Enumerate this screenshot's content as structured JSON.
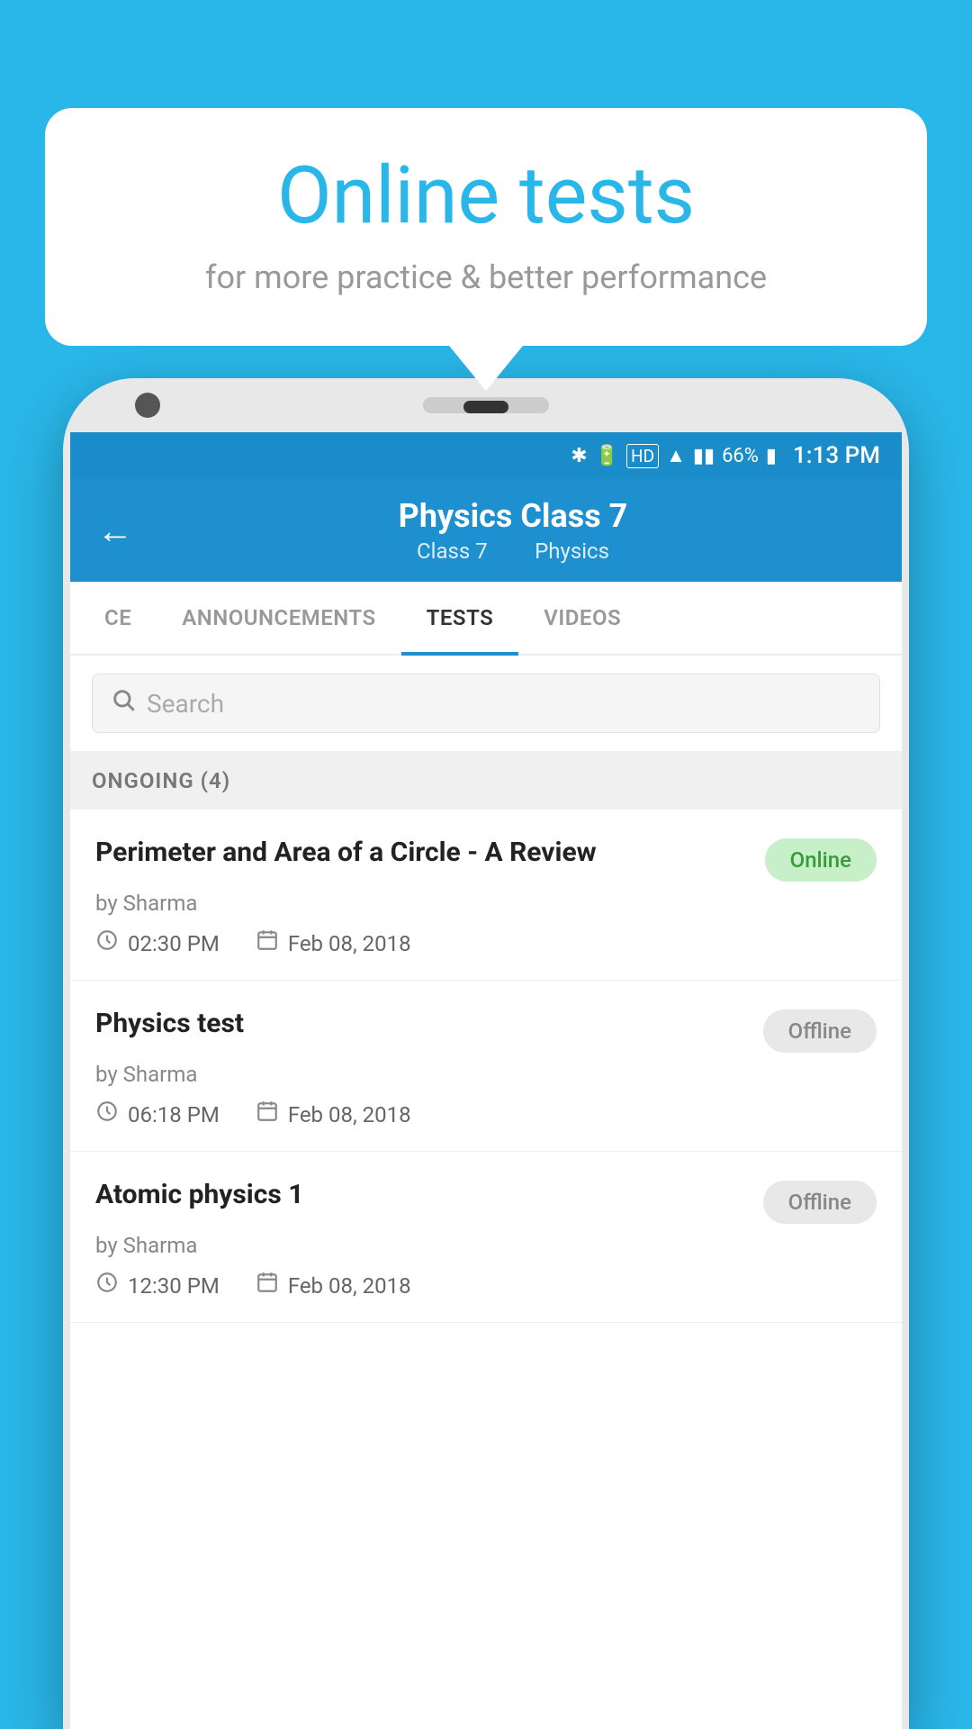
{
  "bubble": {
    "title": "Online tests",
    "subtitle": "for more practice & better performance"
  },
  "statusBar": {
    "battery": "66%",
    "time": "1:13 PM"
  },
  "header": {
    "back_label": "←",
    "title": "Physics Class 7",
    "breadcrumb_class": "Class 7",
    "breadcrumb_subject": "Physics"
  },
  "tabs": [
    {
      "id": "ce",
      "label": "CE",
      "active": false
    },
    {
      "id": "announcements",
      "label": "ANNOUNCEMENTS",
      "active": false
    },
    {
      "id": "tests",
      "label": "TESTS",
      "active": true
    },
    {
      "id": "videos",
      "label": "VIDEOS",
      "active": false
    }
  ],
  "search": {
    "placeholder": "Search"
  },
  "section": {
    "label": "ONGOING (4)"
  },
  "tests": [
    {
      "title": "Perimeter and Area of a Circle - A Review",
      "author": "by Sharma",
      "status": "Online",
      "status_type": "online",
      "time": "02:30 PM",
      "date": "Feb 08, 2018"
    },
    {
      "title": "Physics test",
      "author": "by Sharma",
      "status": "Offline",
      "status_type": "offline",
      "time": "06:18 PM",
      "date": "Feb 08, 2018"
    },
    {
      "title": "Atomic physics 1",
      "author": "by Sharma",
      "status": "Offline",
      "status_type": "offline",
      "time": "12:30 PM",
      "date": "Feb 08, 2018"
    }
  ]
}
